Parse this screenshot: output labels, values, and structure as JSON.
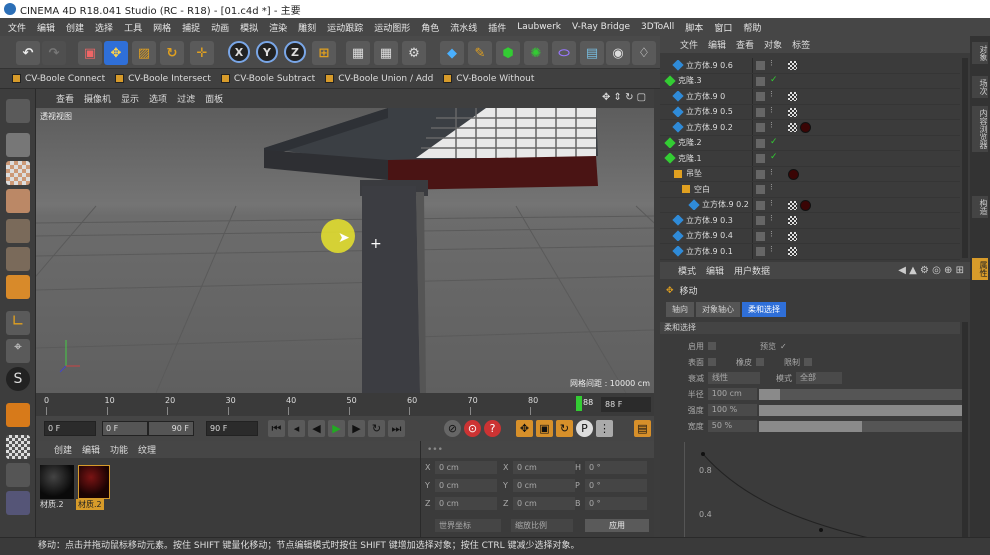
{
  "window": {
    "title": "CINEMA 4D R18.041 Studio (RC - R18) - [01.c4d *] - 主要"
  },
  "menu": [
    "文件",
    "编辑",
    "创建",
    "选择",
    "工具",
    "网格",
    "捕捉",
    "动画",
    "模拟",
    "渲染",
    "雕刻",
    "运动跟踪",
    "运动图形",
    "角色",
    "流水线",
    "插件",
    "Laubwerk",
    "V-Ray Bridge",
    "3DToAll",
    "脚本",
    "窗口",
    "帮助"
  ],
  "plugins": [
    "CV-Boole Connect",
    "CV-Boole Intersect",
    "CV-Boole Subtract",
    "CV-Boole Union / Add",
    "CV-Boole Without"
  ],
  "viewport": {
    "menu": [
      "查看",
      "摄像机",
      "显示",
      "选项",
      "过滤",
      "面板"
    ],
    "label": "透视视图",
    "grid": "网格间距 : 10000 cm"
  },
  "timeline": {
    "ticks": [
      "0",
      "10",
      "20",
      "30",
      "40",
      "50",
      "60",
      "70",
      "80"
    ],
    "current": "88 F",
    "marker": "88"
  },
  "transport": {
    "start": "0 F",
    "range_start": "0 F",
    "range_end": "90 F",
    "end": "90 F"
  },
  "materials": {
    "menu": [
      "创建",
      "编辑",
      "功能",
      "纹理"
    ],
    "items": [
      "材质.2",
      "材质.2"
    ]
  },
  "coords": {
    "rows": [
      {
        "a": "X",
        "av": "0 cm",
        "b": "X",
        "bv": "0 cm",
        "c": "H",
        "cv": "0 °"
      },
      {
        "a": "Y",
        "av": "0 cm",
        "b": "Y",
        "bv": "0 cm",
        "c": "P",
        "cv": "0 °"
      },
      {
        "a": "Z",
        "av": "0 cm",
        "b": "Z",
        "bv": "0 cm",
        "c": "B",
        "cv": "0 °"
      }
    ],
    "world": "世界坐标",
    "scale": "缩放比例",
    "apply": "应用"
  },
  "objects": {
    "menu": [
      "文件",
      "编辑",
      "查看",
      "对象",
      "标签"
    ],
    "rows": [
      {
        "name": "立方体.9 0.6",
        "indent": 1
      },
      {
        "name": "克隆.3",
        "indent": 0
      },
      {
        "name": "立方体.9 0",
        "indent": 1
      },
      {
        "name": "立方体.9 0.5",
        "indent": 1
      },
      {
        "name": "立方体.9 0.2",
        "indent": 1
      },
      {
        "name": "克隆.2",
        "indent": 0
      },
      {
        "name": "克隆.1",
        "indent": 0
      },
      {
        "name": "吊坠",
        "indent": 1
      },
      {
        "name": "空白",
        "indent": 2
      },
      {
        "name": "立方体.9 0.2",
        "indent": 3
      },
      {
        "name": "立方体.9 0.3",
        "indent": 1
      },
      {
        "name": "立方体.9 0.4",
        "indent": 1
      },
      {
        "name": "立方体.9 0.1",
        "indent": 1
      }
    ]
  },
  "attributes": {
    "menu": [
      "模式",
      "编辑",
      "用户数据"
    ],
    "title": "移动",
    "tabs": [
      "轴向",
      "对象轴心",
      "柔和选择"
    ],
    "section": "柔和选择",
    "enable": "启用",
    "preview": "预览",
    "surface": "表面",
    "rubber": "橡皮",
    "clip": "限制",
    "mode_label": "衰减",
    "mode_value": "线性",
    "shape_label": "模式",
    "shape_value": "全部",
    "radius_label": "半径",
    "radius_value": "100 cm",
    "radius_level": 0.1,
    "strength_label": "强度",
    "strength_value": "100 %",
    "strength_level": 1.0,
    "width_label": "宽度",
    "width_value": "50 %",
    "width_level": 0.5,
    "graph": {
      "y_ticks": [
        "0.8",
        "0.4"
      ]
    }
  },
  "side_tabs": [
    "对象",
    "场次",
    "内容浏览器",
    "构造",
    "属性"
  ],
  "status": "移动：点击并拖动鼠标移动元素。按住 SHIFT 键量化移动；节点编辑模式时按住 SHIFT 键增加选择对象；按住 CTRL 键减少选择对象。",
  "colors": {
    "accent": "#d79b2a",
    "selection": "#2f6fd8"
  }
}
